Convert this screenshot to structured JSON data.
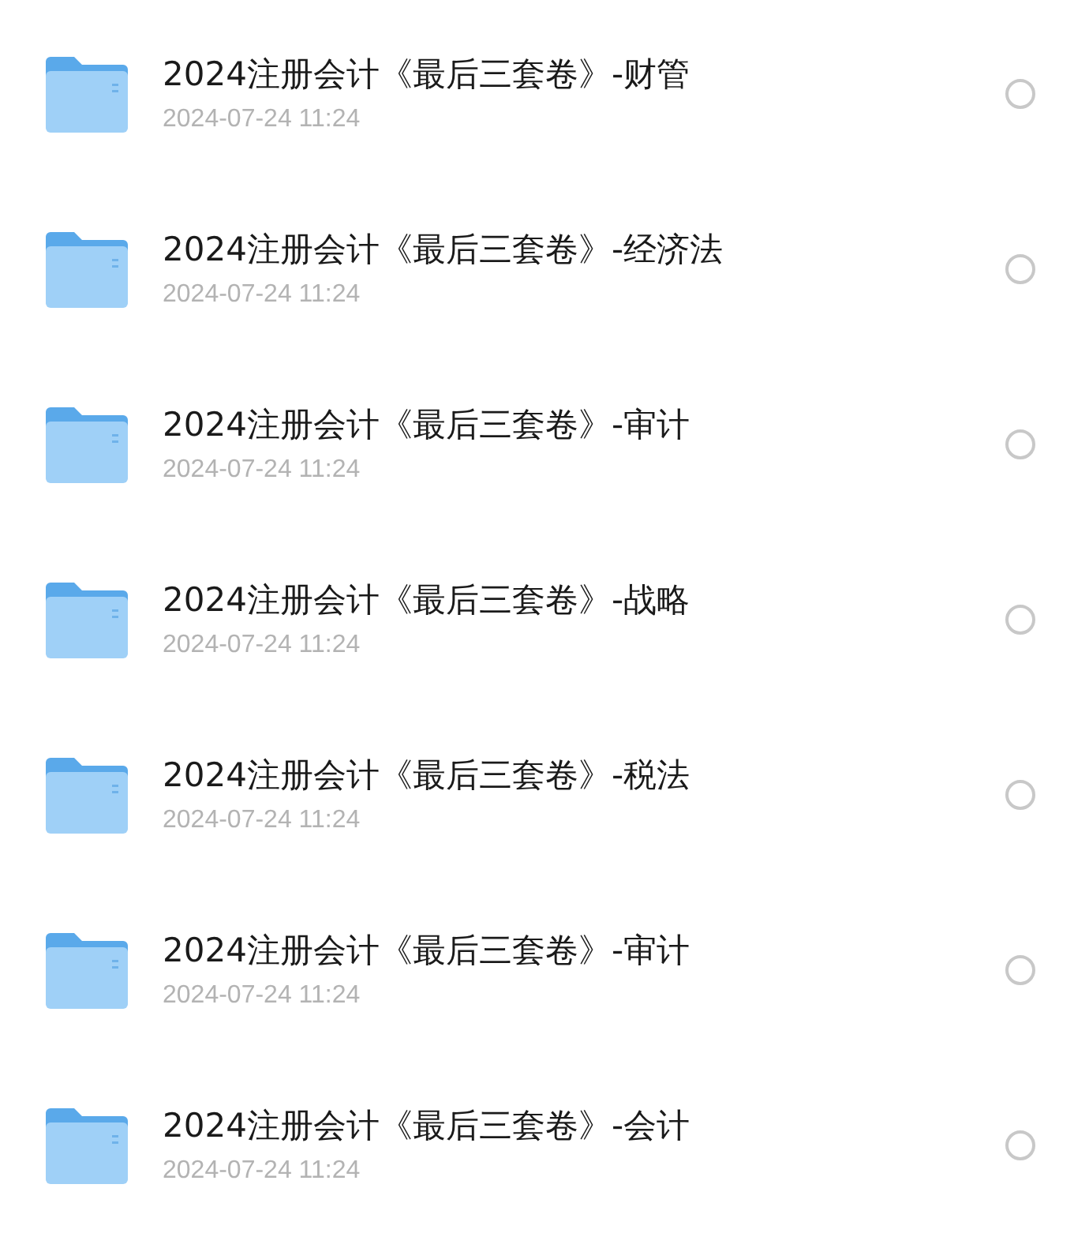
{
  "files": [
    {
      "name": "2024注册会计《最后三套卷》-财管",
      "date": "2024-07-24 11:24",
      "selected": false
    },
    {
      "name": "2024注册会计《最后三套卷》-经济法",
      "date": "2024-07-24 11:24",
      "selected": false
    },
    {
      "name": "2024注册会计《最后三套卷》-审计",
      "date": "2024-07-24 11:24",
      "selected": false
    },
    {
      "name": "2024注册会计《最后三套卷》-战略",
      "date": "2024-07-24 11:24",
      "selected": false
    },
    {
      "name": "2024注册会计《最后三套卷》-税法",
      "date": "2024-07-24 11:24",
      "selected": false
    },
    {
      "name": "2024注册会计《最后三套卷》-审计",
      "date": "2024-07-24 11:24",
      "selected": false
    },
    {
      "name": "2024注册会计《最后三套卷》-会计",
      "date": "2024-07-24 11:24",
      "selected": false
    }
  ]
}
